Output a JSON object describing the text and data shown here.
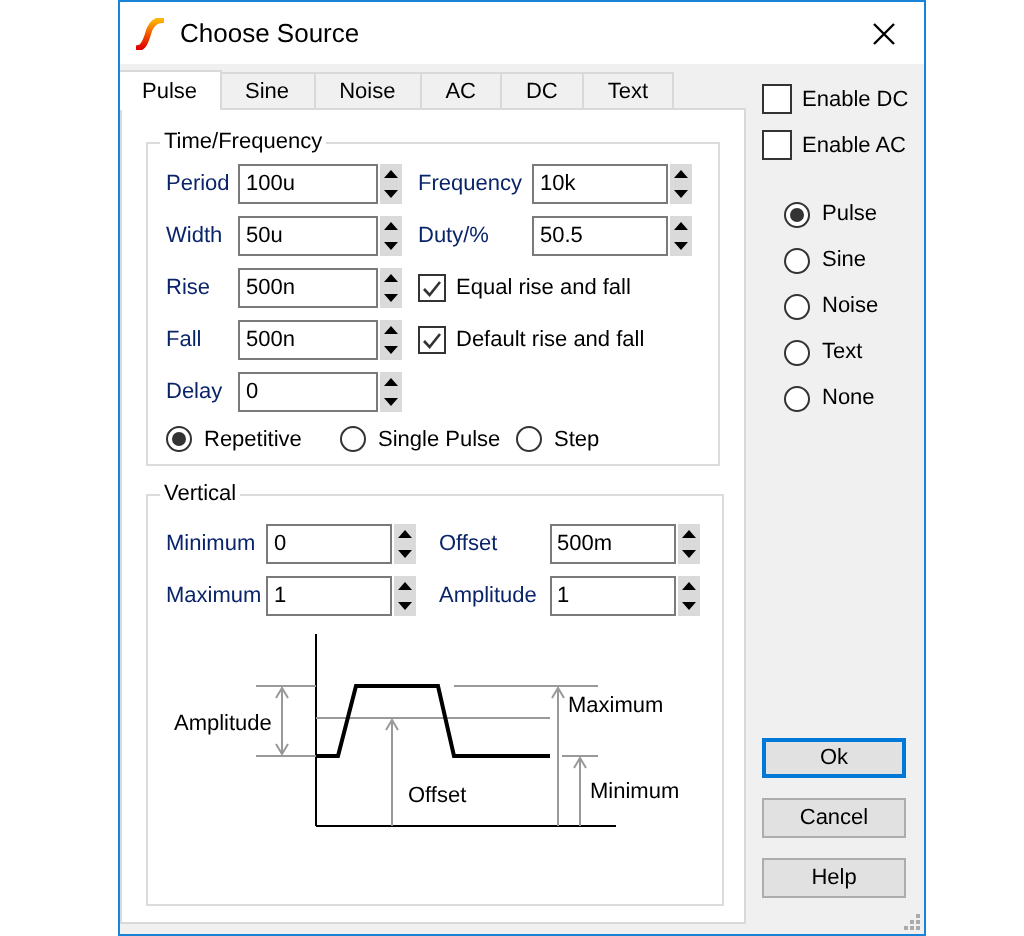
{
  "window": {
    "title": "Choose Source"
  },
  "tabs": [
    {
      "label": "Pulse",
      "selected": true
    },
    {
      "label": "Sine",
      "selected": false
    },
    {
      "label": "Noise",
      "selected": false
    },
    {
      "label": "AC",
      "selected": false
    },
    {
      "label": "DC",
      "selected": false
    },
    {
      "label": "Text",
      "selected": false
    }
  ],
  "time_frequency": {
    "title": "Time/Frequency",
    "left_fields": [
      {
        "label": "Period",
        "value": "100u"
      },
      {
        "label": "Width",
        "value": "50u"
      },
      {
        "label": "Rise",
        "value": "500n"
      },
      {
        "label": "Fall",
        "value": "500n"
      },
      {
        "label": "Delay",
        "value": "0"
      }
    ],
    "right_fields": [
      {
        "label": "Frequency",
        "value": "10k"
      },
      {
        "label": "Duty/%",
        "value": "50.5"
      }
    ],
    "checkboxes": [
      {
        "label": "Equal rise and fall",
        "checked": true
      },
      {
        "label": "Default rise and fall",
        "checked": true
      }
    ],
    "modes": [
      {
        "label": "Repetitive",
        "selected": true
      },
      {
        "label": "Single Pulse",
        "selected": false
      },
      {
        "label": "Step",
        "selected": false
      }
    ]
  },
  "vertical": {
    "title": "Vertical",
    "fields": [
      {
        "label": "Minimum",
        "value": "0"
      },
      {
        "label": "Offset",
        "value": "500m"
      },
      {
        "label": "Maximum",
        "value": "1"
      },
      {
        "label": "Amplitude",
        "value": "1"
      }
    ],
    "diagram": {
      "amplitude_label": "Amplitude",
      "maximum_label": "Maximum",
      "offset_label": "Offset",
      "minimum_label": "Minimum"
    }
  },
  "enable": [
    {
      "label": "Enable DC",
      "checked": false
    },
    {
      "label": "Enable AC",
      "checked": false
    }
  ],
  "source_types": [
    {
      "label": "Pulse",
      "selected": true
    },
    {
      "label": "Sine",
      "selected": false
    },
    {
      "label": "Noise",
      "selected": false
    },
    {
      "label": "Text",
      "selected": false
    },
    {
      "label": "None",
      "selected": false
    }
  ],
  "buttons": [
    {
      "label": "Ok",
      "default": true
    },
    {
      "label": "Cancel",
      "default": false
    },
    {
      "label": "Help",
      "default": false
    }
  ]
}
